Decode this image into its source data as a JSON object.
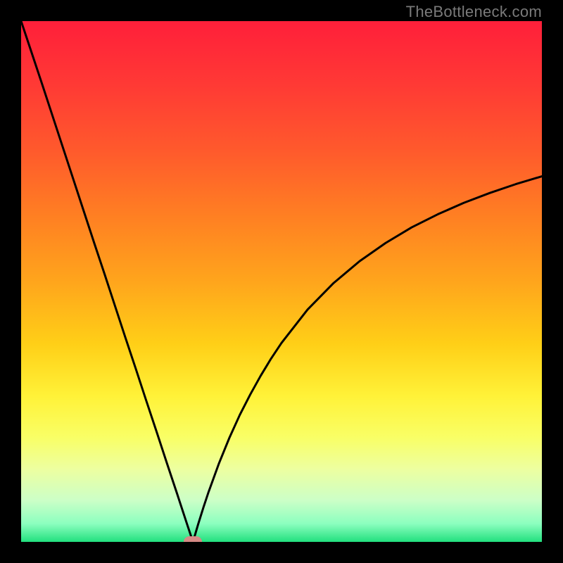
{
  "watermark": "TheBottleneck.com",
  "colors": {
    "gradient_stops": [
      {
        "offset": 0.0,
        "color": "#ff1f3a"
      },
      {
        "offset": 0.12,
        "color": "#ff3935"
      },
      {
        "offset": 0.25,
        "color": "#ff5a2c"
      },
      {
        "offset": 0.38,
        "color": "#ff8122"
      },
      {
        "offset": 0.5,
        "color": "#ffa51c"
      },
      {
        "offset": 0.62,
        "color": "#ffcf17"
      },
      {
        "offset": 0.72,
        "color": "#fff238"
      },
      {
        "offset": 0.8,
        "color": "#f9ff66"
      },
      {
        "offset": 0.86,
        "color": "#edffa0"
      },
      {
        "offset": 0.92,
        "color": "#ccffc7"
      },
      {
        "offset": 0.965,
        "color": "#8cffbf"
      },
      {
        "offset": 1.0,
        "color": "#22e07e"
      }
    ],
    "curve_stroke": "#000000",
    "marker_fill": "#d58a85",
    "frame_bg": "#000000"
  },
  "chart_data": {
    "type": "line",
    "title": "",
    "xlabel": "",
    "ylabel": "",
    "xlim": [
      0,
      100
    ],
    "ylim": [
      0,
      100
    ],
    "x": [
      0,
      2,
      4,
      6,
      8,
      10,
      12,
      14,
      16,
      18,
      20,
      22,
      24,
      26,
      28,
      30,
      32,
      33,
      34,
      35,
      36,
      38,
      40,
      42,
      44,
      46,
      48,
      50,
      55,
      60,
      65,
      70,
      75,
      80,
      85,
      90,
      95,
      100
    ],
    "values": [
      100,
      94.0,
      88.0,
      81.9,
      75.8,
      69.7,
      63.6,
      57.5,
      51.5,
      45.4,
      39.3,
      33.3,
      27.2,
      21.2,
      15.1,
      9.1,
      3.0,
      0.0,
      3.4,
      6.6,
      9.6,
      15.1,
      20.0,
      24.4,
      28.3,
      31.9,
      35.2,
      38.2,
      44.6,
      49.7,
      53.9,
      57.4,
      60.4,
      62.9,
      65.1,
      67.0,
      68.7,
      70.2
    ],
    "marker": {
      "x": 33,
      "y": 0
    },
    "notes": "y is percent-like (bottleneck %); minimum at x≈33. Left branch near-linear from (0,100) to (33,0); right branch rises with diminishing slope toward ≈70 at x=100."
  }
}
